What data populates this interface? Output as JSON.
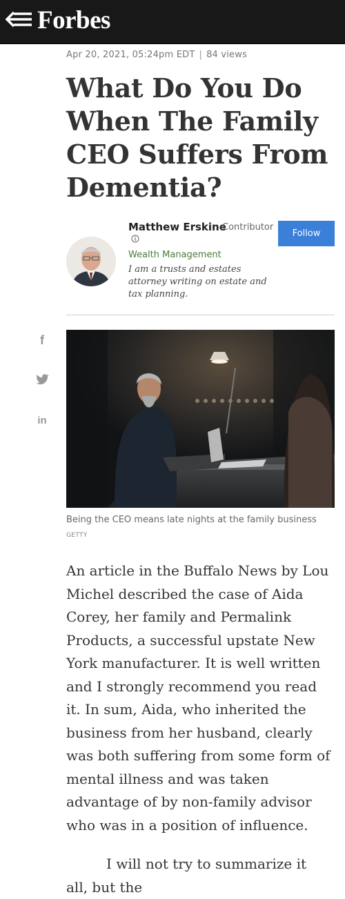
{
  "header": {
    "logo": "Forbes",
    "menu_icon": "menu-back-icon"
  },
  "article": {
    "date": "Apr 20, 2021, 05:24pm EDT",
    "views": "84 views",
    "separator": "|",
    "title": "What Do You Do When The Family CEO Suffers From Dementia?"
  },
  "author": {
    "name": "Matthew Erskine",
    "role": "Contributor",
    "section": "Wealth Management",
    "bio": "I am a trusts and estates attorney writing on estate and tax planning.",
    "follow_label": "Follow"
  },
  "share": {
    "facebook": "f",
    "linkedin": "in"
  },
  "image": {
    "caption": "Being the CEO means late nights at the family business",
    "credit": "GETTY"
  },
  "body": {
    "paragraph1": "An article in the Buffalo News by Lou Michel described the case of Aida Corey, her family and Permalink Products, a successful upstate New York manufacturer. It is well written and I strongly recommend you read it. In sum, Aida, who inherited the business from her husband, clearly was both suffering from some form of mental illness and was taken advantage of by non-family advisor who was in a position of influence.",
    "paragraph2": "I will not try to summarize it all, but the"
  },
  "colors": {
    "topbar": "#181818",
    "follow_button": "#3a80d8",
    "section_link": "#4a7b3a"
  }
}
